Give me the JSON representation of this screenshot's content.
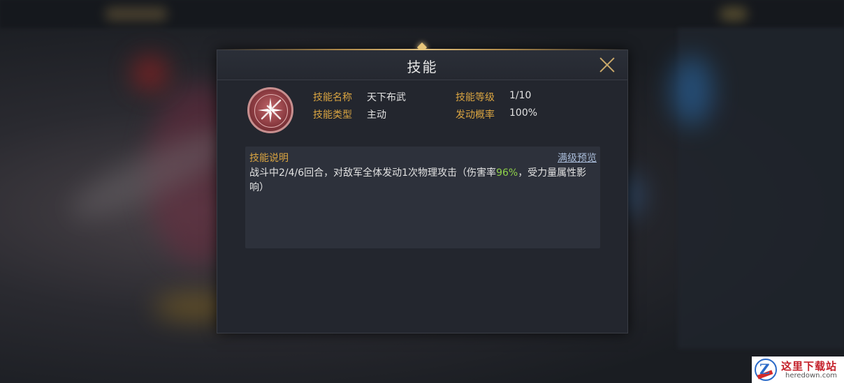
{
  "dialog": {
    "title": "技能",
    "skill_name_label": "技能名称",
    "skill_name": "天下布武",
    "skill_level_label": "技能等级",
    "skill_level": "1/10",
    "skill_type_label": "技能类型",
    "skill_type": "主动",
    "trigger_rate_label": "发动概率",
    "trigger_rate": "100%",
    "description_label": "技能说明",
    "max_level_preview": "满级预览",
    "description_part1": "战斗中2/4/6回合，对敌军全体发动1次物理攻击（伤害率",
    "description_highlight": "96%",
    "description_part2": "，受力量属性影响）",
    "highlight_color": "#8fd14a",
    "label_color": "#d9a441"
  },
  "icons": {
    "close": "close-icon",
    "skill": "crossed-swords-skill-icon"
  },
  "watermark": {
    "logo_letter": "Z",
    "site_cn": "这里下载站",
    "site_en": "heredown.com"
  }
}
